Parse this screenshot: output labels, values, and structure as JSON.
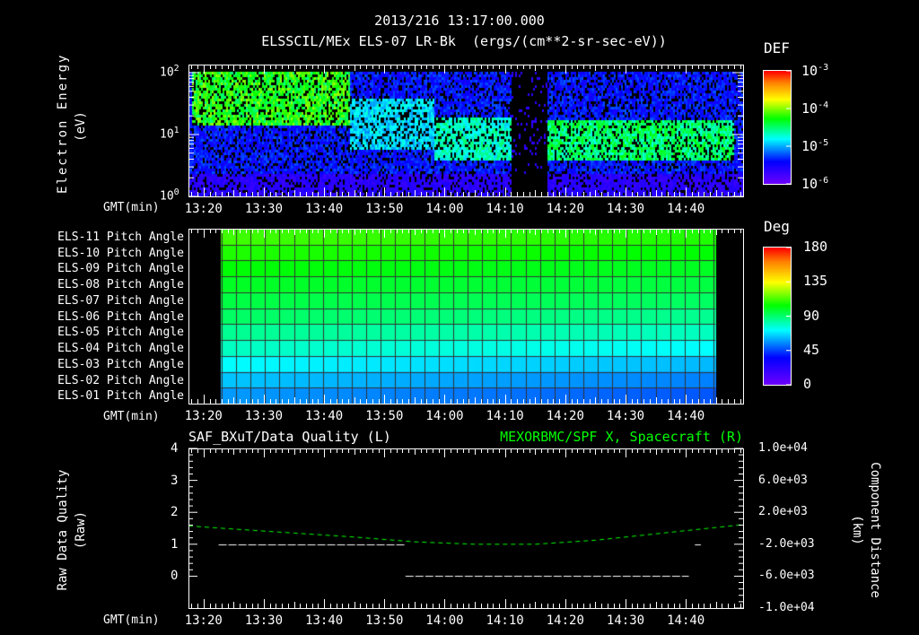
{
  "header": {
    "timestamp": "2013/216 13:17:00.000",
    "title": "ELSSCIL/MEx ELS-07 LR-Bk  (ergs/(cm**2-sr-sec-eV))"
  },
  "colors": {
    "background": "#000000",
    "axis": "#ffffff",
    "spacecraft_line": "#00ff00",
    "quality_line": "#ffffff"
  },
  "chart_data": [
    {
      "type": "heatmap",
      "name": "electron-spectrogram",
      "title": "ELSSCIL/MEx ELS-07 LR-Bk  (ergs/(cm**2-sr-sec-eV))",
      "xlabel": "GMT(min)",
      "ylabel": "Electron Energy",
      "ylabel_units": "(eV)",
      "yscale": "log",
      "ylim": [
        1,
        135
      ],
      "yticks": [
        {
          "v": 1,
          "label": "10",
          "exp": "0"
        },
        {
          "v": 10,
          "label": "10",
          "exp": "1"
        },
        {
          "v": 100,
          "label": "10",
          "exp": "2"
        }
      ],
      "xlim_min": [
        797.5,
        889.5
      ],
      "xticks": [
        "13:20",
        "13:30",
        "13:40",
        "13:50",
        "14:00",
        "14:10",
        "14:20",
        "14:30",
        "14:40"
      ],
      "xtick_min": [
        800,
        810,
        820,
        830,
        840,
        850,
        860,
        870,
        880
      ],
      "colorbar": {
        "label": "DEF",
        "scale": "log",
        "range": [
          1e-06,
          0.001
        ],
        "ticks": [
          {
            "label": "10",
            "exp": "-3"
          },
          {
            "label": "10",
            "exp": "-4"
          },
          {
            "label": "10",
            "exp": "-5"
          },
          {
            "label": "10",
            "exp": "-6"
          }
        ]
      },
      "regions": [
        {
          "t0": 798,
          "t1": 824,
          "e_lo": 15,
          "e_hi": 110,
          "level": 0.6
        },
        {
          "t0": 824,
          "t1": 838,
          "e_lo": 6,
          "e_hi": 40,
          "level": 0.38
        },
        {
          "t0": 838,
          "t1": 851,
          "e_lo": 4,
          "e_hi": 20,
          "level": 0.45
        },
        {
          "t0": 851,
          "t1": 857,
          "e_lo": 1,
          "e_hi": 135,
          "level": 0.0
        },
        {
          "t0": 857,
          "t1": 888,
          "e_lo": 4,
          "e_hi": 18,
          "level": 0.52
        }
      ]
    },
    {
      "type": "heatmap",
      "name": "pitch-angle",
      "xlabel": "GMT(min)",
      "rows": [
        "ELS-11 Pitch Angle",
        "ELS-10 Pitch Angle",
        "ELS-09 Pitch Angle",
        "ELS-08 Pitch Angle",
        "ELS-07 Pitch Angle",
        "ELS-06 Pitch Angle",
        "ELS-05 Pitch Angle",
        "ELS-04 Pitch Angle",
        "ELS-03 Pitch Angle",
        "ELS-02 Pitch Angle",
        "ELS-01 Pitch Angle"
      ],
      "row_values_deg_start": [
        112,
        108,
        104,
        100,
        96,
        92,
        86,
        80,
        72,
        64,
        58
      ],
      "row_values_deg_end": [
        108,
        104,
        100,
        96,
        92,
        86,
        80,
        72,
        62,
        54,
        48
      ],
      "data_time_range_min": [
        802.9,
        884.9
      ],
      "xlim_min": [
        797.5,
        889.5
      ],
      "xticks": [
        "13:20",
        "13:30",
        "13:40",
        "13:50",
        "14:00",
        "14:10",
        "14:20",
        "14:30",
        "14:40"
      ],
      "colorbar": {
        "label": "Deg",
        "range": [
          0,
          180
        ],
        "ticks": [
          "180",
          "135",
          "90",
          "45",
          "0"
        ]
      }
    },
    {
      "type": "line",
      "name": "quality-and-position",
      "title_left": "SAF_BXuT/Data Quality (L)",
      "title_right": "MEXORBMC/SPF X, Spacecraft (R)",
      "ylabel_left": "Raw Data Quality",
      "ylabel_left_units": "(Raw)",
      "ylabel_right": "Component Distance",
      "ylabel_right_units": "(km)",
      "xlabel": "GMT(min)",
      "xlim_min": [
        797.5,
        889.5
      ],
      "xticks": [
        "13:20",
        "13:30",
        "13:40",
        "13:50",
        "14:00",
        "14:10",
        "14:20",
        "14:30",
        "14:40"
      ],
      "ylim_left": [
        -1,
        4
      ],
      "yticks_left": [
        "0",
        "1",
        "2",
        "3",
        "4"
      ],
      "ylim_right": [
        -10000,
        10000
      ],
      "yticks_right": [
        "1.0e+04",
        "6.0e+03",
        "2.0e+03",
        "-2.0e+03",
        "-6.0e+03",
        "-1.0e+04"
      ],
      "series": [
        {
          "name": "Data Quality",
          "axis": "left",
          "color": "#ffffff",
          "segments": [
            [
              [
                802.5,
                1
              ],
              [
                833.5,
                1
              ]
            ],
            [
              [
                833.5,
                0
              ],
              [
                880.5,
                0
              ]
            ],
            [
              [
                881.5,
                1
              ],
              [
                882.5,
                1
              ]
            ]
          ]
        },
        {
          "name": "Spacecraft X",
          "axis": "right",
          "color": "#00ff00",
          "dashed": true,
          "x": [
            797.5,
            805,
            815,
            825,
            835,
            845,
            855,
            865,
            875,
            885,
            889.5
          ],
          "y": [
            300,
            -100,
            -600,
            -1100,
            -1700,
            -2000,
            -2000,
            -1500,
            -700,
            100,
            450
          ]
        }
      ]
    }
  ]
}
